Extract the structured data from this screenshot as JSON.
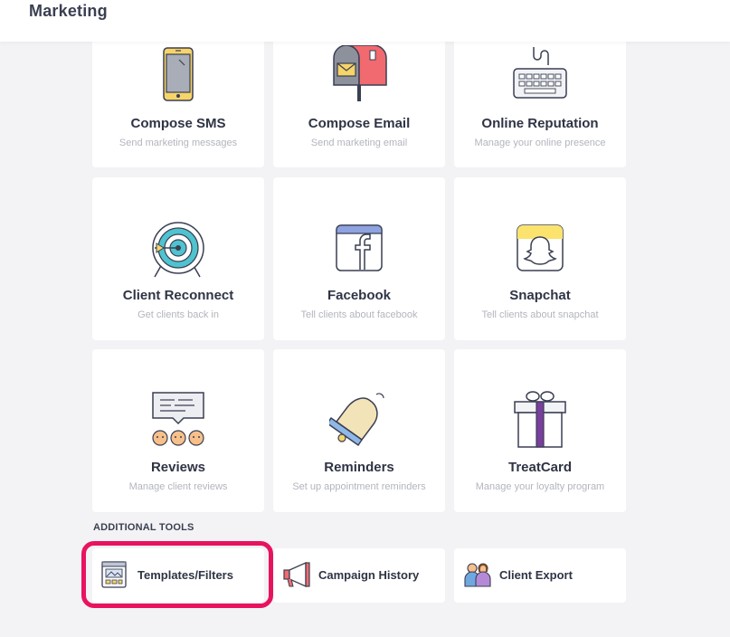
{
  "header": {
    "title": "Marketing"
  },
  "cards": [
    {
      "title": "Compose SMS",
      "subtitle": "Send marketing messages",
      "icon": "phone-icon"
    },
    {
      "title": "Compose Email",
      "subtitle": "Send marketing email",
      "icon": "mailbox-icon"
    },
    {
      "title": "Online Reputation",
      "subtitle": "Manage your online presence",
      "icon": "keyboard-icon"
    },
    {
      "title": "Client Reconnect",
      "subtitle": "Get clients back in",
      "icon": "target-icon"
    },
    {
      "title": "Facebook",
      "subtitle": "Tell clients about facebook",
      "icon": "facebook-icon"
    },
    {
      "title": "Snapchat",
      "subtitle": "Tell clients about snapchat",
      "icon": "snapchat-icon"
    },
    {
      "title": "Reviews",
      "subtitle": "Manage client reviews",
      "icon": "reviews-icon"
    },
    {
      "title": "Reminders",
      "subtitle": "Set up appointment reminders",
      "icon": "bell-icon"
    },
    {
      "title": "TreatCard",
      "subtitle": "Manage your loyalty program",
      "icon": "gift-icon"
    }
  ],
  "additional_tools": {
    "label": "ADDITIONAL TOOLS",
    "items": [
      {
        "label": "Templates/Filters",
        "icon": "template-icon",
        "highlighted": true
      },
      {
        "label": "Campaign History",
        "icon": "megaphone-icon"
      },
      {
        "label": "Client Export",
        "icon": "users-icon"
      }
    ]
  },
  "colors": {
    "highlight": "#e8135f",
    "background": "#f3f3f5",
    "card": "#ffffff",
    "accent_teal": "#4fc3cf",
    "accent_yellow": "#f7d46a"
  }
}
